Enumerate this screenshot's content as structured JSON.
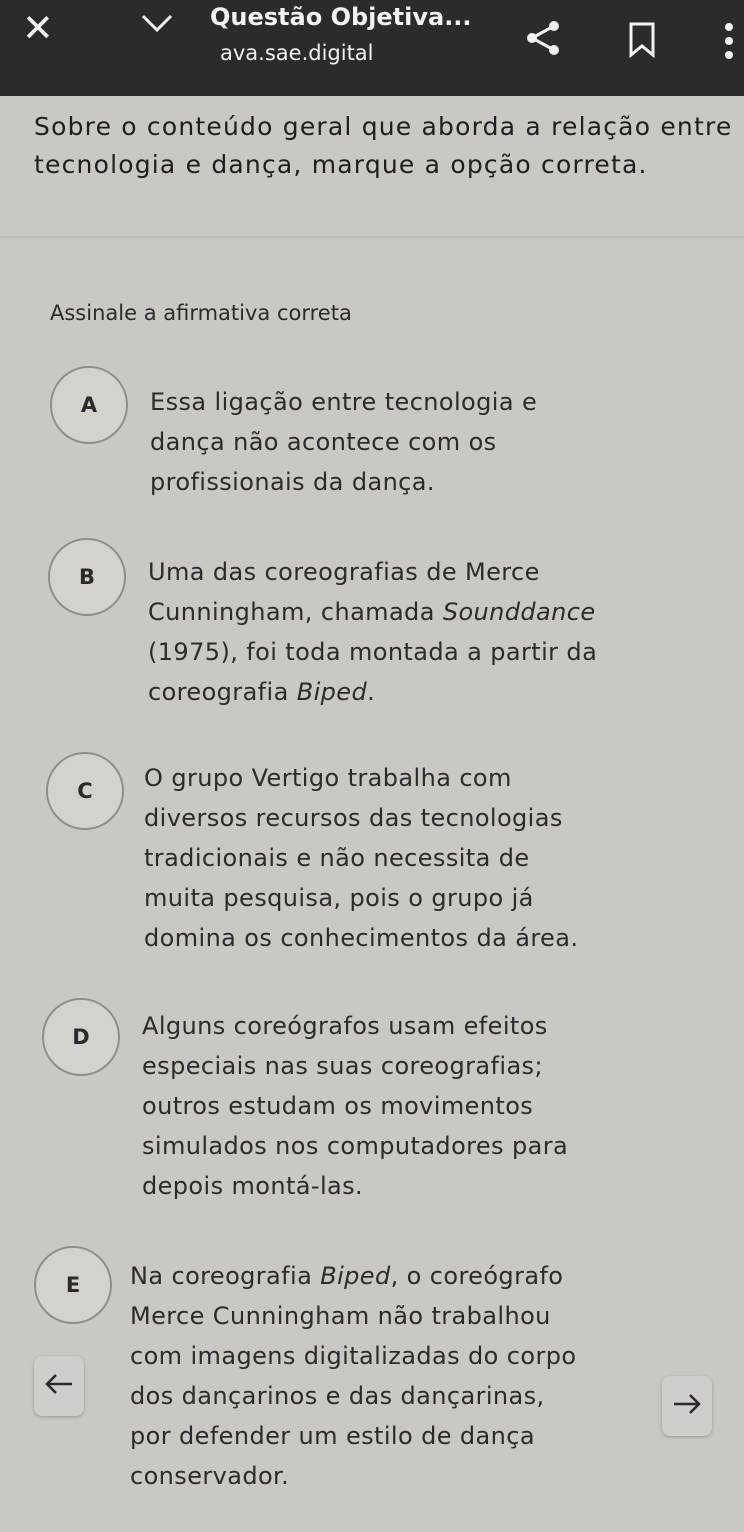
{
  "browser": {
    "title": "Questão Objetiva...",
    "url": "ava.sae.digital",
    "icons": [
      "close-icon",
      "chevron-down-icon",
      "share-icon",
      "bookmark-icon",
      "more-vert-icon"
    ]
  },
  "question": {
    "statement": "Sobre o conteúdo geral que aborda a relação entre tecnologia e dança, marque a opção correta.",
    "instruction": "Assinale a afirmativa correta"
  },
  "options": [
    {
      "letter": "A",
      "lines": [
        "Essa ligação entre tecnologia e",
        "dança não acontece com os",
        "profissionais da dança."
      ]
    },
    {
      "letter": "B",
      "lines": [
        "Uma das coreografias de Merce",
        "Cunningham, chamada Sounddance",
        "(1975), foi toda montada a partir da",
        "coreografia Biped."
      ]
    },
    {
      "letter": "C",
      "lines": [
        "O grupo Vertigo trabalha com",
        "diversos recursos das tecnologias",
        "tradicionais e não necessita de",
        "muita pesquisa, pois o grupo já",
        "domina os conhecimentos da área."
      ]
    },
    {
      "letter": "D",
      "lines": [
        "Alguns coreógrafos usam efeitos",
        "especiais nas suas coreografias;",
        "outros estudam os movimentos",
        "simulados nos computadores para",
        "depois montá-las."
      ]
    },
    {
      "letter": "E",
      "lines": [
        "Na coreografia Biped, o coreógrafo",
        "Merce Cunningham não trabalhou",
        "com imagens digitalizadas do corpo",
        "dos dançarinos e das dançarinas,",
        "por defender um estilo de dança",
        "conservador."
      ]
    }
  ],
  "navigation": {
    "prev_icon": "arrow-left-icon",
    "next_icon": "arrow-right-icon"
  }
}
